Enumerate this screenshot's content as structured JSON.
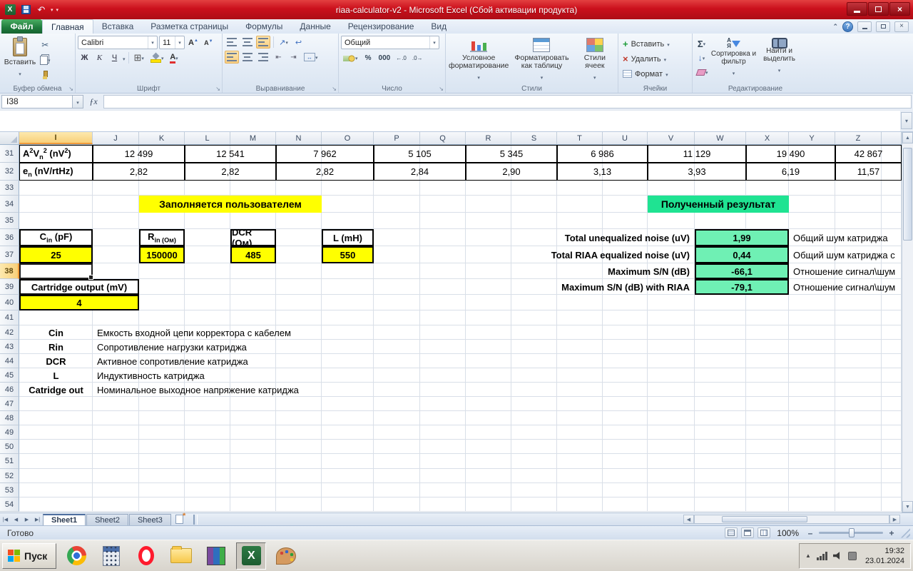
{
  "window": {
    "title": "riaa-calculator-v2  -  Microsoft Excel (Сбой активации продукта)"
  },
  "ribbon": {
    "file_tab": "Файл",
    "tabs": [
      "Главная",
      "Вставка",
      "Разметка страницы",
      "Формулы",
      "Данные",
      "Рецензирование",
      "Вид"
    ],
    "help": "?",
    "clipboard": {
      "label": "Буфер обмена",
      "paste": "Вставить"
    },
    "font": {
      "label": "Шрифт",
      "name": "Calibri",
      "size": "11",
      "bold": "Ж",
      "italic": "К",
      "underline": "Ч",
      "grow": "А",
      "shrink": "А",
      "color_letter": "А"
    },
    "alignment": {
      "label": "Выравнивание"
    },
    "number": {
      "label": "Число",
      "format": "Общий",
      "percent": "%",
      "thousands": "000"
    },
    "styles": {
      "label": "Стили",
      "conditional": "Условное форматирование",
      "as_table": "Форматировать как таблицу",
      "cell_styles": "Стили ячеек"
    },
    "cells": {
      "label": "Ячейки",
      "insert": "Вставить",
      "del": "Удалить",
      "format": "Формат"
    },
    "editing": {
      "label": "Редактирование",
      "autosum": "Σ",
      "sort": "Сортировка и фильтр",
      "find": "Найти и выделить"
    }
  },
  "formula_bar": {
    "name_box": "I38",
    "fx": "ƒx",
    "content": ""
  },
  "grid": {
    "columns": [
      "I",
      "J",
      "K",
      "L",
      "M",
      "N",
      "O",
      "P",
      "Q",
      "R",
      "S",
      "T",
      "U",
      "V",
      "W",
      "X",
      "Y",
      "Z"
    ],
    "rows_start": 31,
    "active_col": "I",
    "active_row": 38,
    "active_cell": "I38",
    "noise_table": {
      "row31_label_html": "A<sup>2</sup>V<sub>n</sub><sup>2</sup> (nV<sup>2</sup>)",
      "row32_label_html": "e<sub>n</sub> (nV/rtHz)",
      "row31_values": [
        "12 499",
        "12 541",
        "7 962",
        "5 105",
        "5 345",
        "6 986",
        "11 129",
        "19 490",
        "42 867"
      ],
      "row32_values": [
        "2,82",
        "2,82",
        "2,82",
        "2,84",
        "2,90",
        "3,13",
        "3,93",
        "6,19",
        "11,57"
      ]
    },
    "user_banner": "Заполняется пользователем",
    "result_banner": "Полученный результат",
    "inputs": [
      {
        "label_html": "C<sub>in</sub> (pF)",
        "value": "25"
      },
      {
        "label_html": "R<sub>in (Ом)</sub>",
        "value": "150000"
      },
      {
        "label_html": "DCR (Ом)",
        "value": "485"
      },
      {
        "label_html": "L (mH)",
        "value": "550"
      }
    ],
    "cartridge": {
      "label": "Cartridge output (mV)",
      "value": "4"
    },
    "results": [
      {
        "label": "Total unequalized noise (uV)",
        "value": "1,99",
        "note": "Общий шум катриджа"
      },
      {
        "label": "Total RIAA equalized noise (uV)",
        "value": "0,44",
        "note": "Общий шум катриджа с"
      },
      {
        "label": "Maximum S/N (dB)",
        "value": "-66,1",
        "note": "Отношение сигнал\\шум"
      },
      {
        "label": "Maximum S/N (dB) with RIAA",
        "value": "-79,1",
        "note": "Отношение сигнал\\шум"
      }
    ],
    "legend": [
      {
        "term": "Cin",
        "desc": "Емкость входной цепи корректора с кабелем"
      },
      {
        "term": "Rin",
        "desc": "Сопротивление нагрузки катриджа"
      },
      {
        "term": "DCR",
        "desc": "Активное сопротивление катриджа"
      },
      {
        "term": "L",
        "desc": "Индуктивность катриджа"
      },
      {
        "term": "Catridge out",
        "desc": "Номинальное выходное напряжение катриджа"
      }
    ]
  },
  "sheet_strip": {
    "tabs": [
      "Sheet1",
      "Sheet2",
      "Sheet3"
    ],
    "active_tab": "Sheet1"
  },
  "status_bar": {
    "ready": "Готово",
    "zoom": "100%"
  },
  "taskbar": {
    "start": "Пуск",
    "time": "19:32",
    "date": "23.01.2024"
  }
}
